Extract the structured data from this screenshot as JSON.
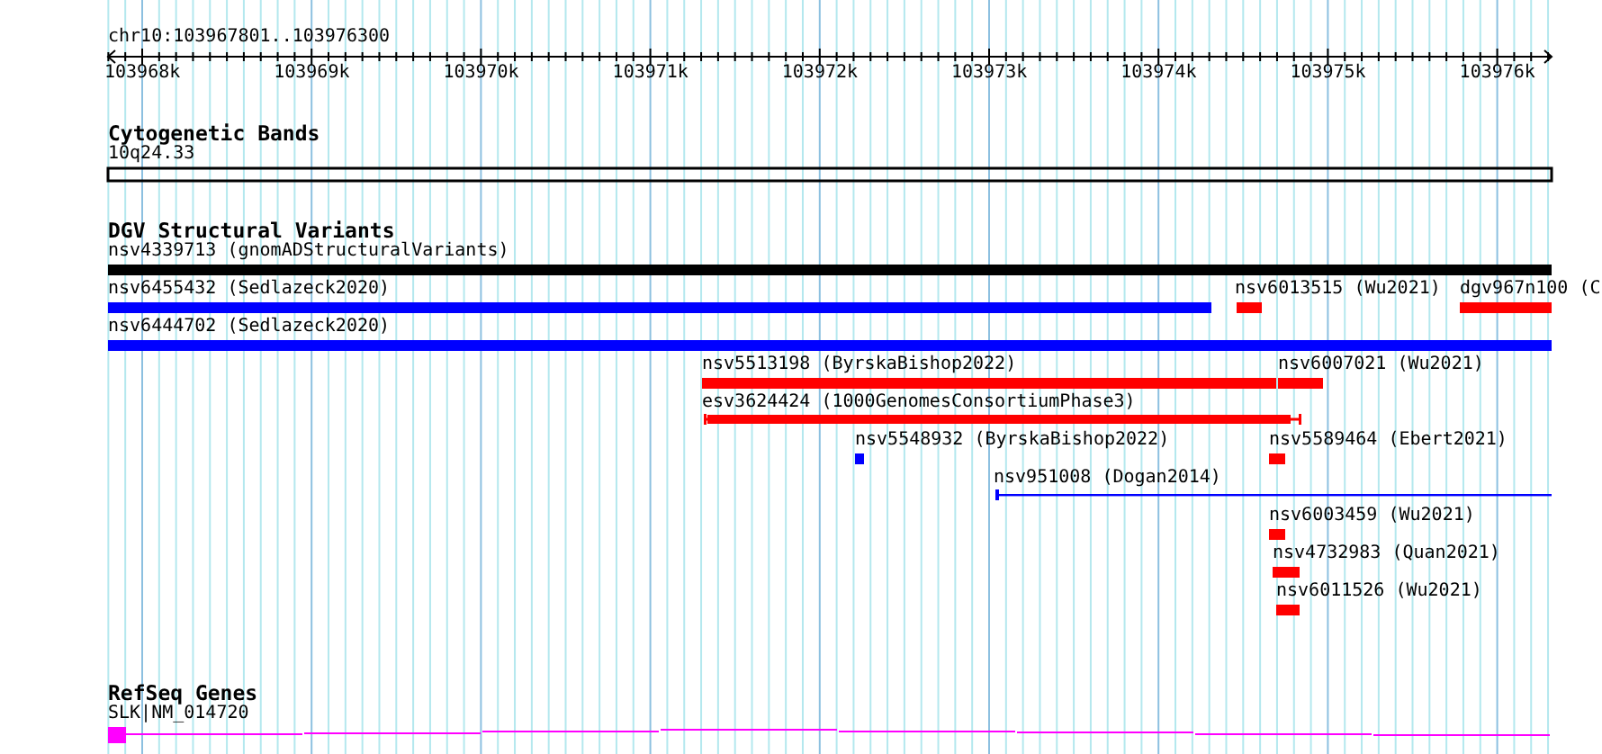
{
  "location": "chr10:103967801..103976300",
  "ruler": {
    "ticks": [
      "103968k",
      "103969k",
      "103970k",
      "103971k",
      "103972k",
      "103973k",
      "103974k",
      "103975k",
      "103976k"
    ]
  },
  "tracks": [
    {
      "title": "Cytogenetic Bands",
      "features": [
        {
          "label": "10q24.33",
          "kind": "band",
          "color": "#000000"
        }
      ]
    },
    {
      "title": "DGV Structural Variants",
      "features": [
        {
          "label": "nsv4339713 (gnomADStructuralVariants)",
          "kind": "bar",
          "color": "#000000"
        },
        {
          "label": "nsv6455432 (Sedlazeck2020)",
          "kind": "bar",
          "color": "#0000ff"
        },
        {
          "label": "nsv6013515 (Wu2021)",
          "kind": "bar",
          "color": "#ff0000"
        },
        {
          "label": "dgv967n100 (C",
          "kind": "bar",
          "color": "#ff0000"
        },
        {
          "label": "nsv6444702 (Sedlazeck2020)",
          "kind": "bar",
          "color": "#0000ff"
        },
        {
          "label": "nsv5513198 (ByrskaBishop2022)",
          "kind": "bar",
          "color": "#ff0000"
        },
        {
          "label": "nsv6007021 (Wu2021)",
          "kind": "bar",
          "color": "#ff0000"
        },
        {
          "label": "esv3624424 (1000GenomesConsortiumPhase3)",
          "kind": "whisker",
          "color": "#ff0000"
        },
        {
          "label": "nsv5548932 (ByrskaBishop2022)",
          "kind": "bar",
          "color": "#0000ff"
        },
        {
          "label": "nsv5589464 (Ebert2021)",
          "kind": "bar",
          "color": "#ff0000"
        },
        {
          "label": "nsv951008 (Dogan2014)",
          "kind": "line",
          "color": "#0000ff"
        },
        {
          "label": "nsv6003459 (Wu2021)",
          "kind": "bar",
          "color": "#ff0000"
        },
        {
          "label": "nsv4732983 (Quan2021)",
          "kind": "bar",
          "color": "#ff0000"
        },
        {
          "label": "nsv6011526 (Wu2021)",
          "kind": "bar",
          "color": "#ff0000"
        }
      ]
    },
    {
      "title": "RefSeq Genes",
      "features": [
        {
          "label": "SLK|NM_014720",
          "kind": "gene",
          "color": "#ff00ff"
        }
      ]
    }
  ]
}
